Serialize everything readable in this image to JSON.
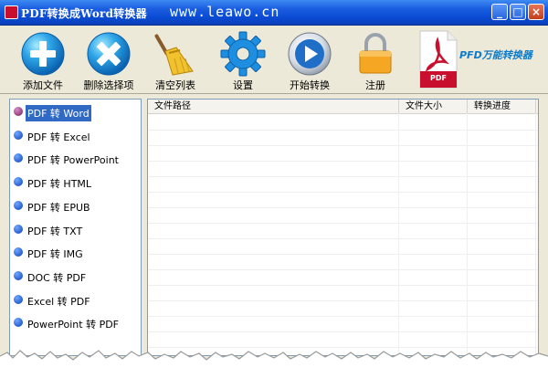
{
  "window": {
    "title": "PDF转换成Word转换器",
    "url": "www.leawo.cn",
    "controls": {
      "minimize": "_",
      "maximize": "□",
      "close": "×"
    }
  },
  "toolbar": {
    "items": [
      {
        "label": "添加文件",
        "icon": "add-icon"
      },
      {
        "label": "删除选择项",
        "icon": "remove-icon"
      },
      {
        "label": "清空列表",
        "icon": "broom-icon"
      },
      {
        "label": "设置",
        "icon": "gear-icon"
      },
      {
        "label": "开始转换",
        "icon": "play-icon"
      },
      {
        "label": "注册",
        "icon": "lock-icon"
      }
    ],
    "brand": {
      "text": "PFD万能转换器",
      "logo_text": "PDF",
      "icon": "pdf-logo-icon"
    }
  },
  "conversion_options": [
    {
      "label": "PDF 转 Word",
      "selected": true
    },
    {
      "label": "PDF 转 Excel",
      "selected": false
    },
    {
      "label": "PDF 转 PowerPoint",
      "selected": false
    },
    {
      "label": "PDF 转 HTML",
      "selected": false
    },
    {
      "label": "PDF 转 EPUB",
      "selected": false
    },
    {
      "label": "PDF 转 TXT",
      "selected": false
    },
    {
      "label": "PDF 转 IMG",
      "selected": false
    },
    {
      "label": "DOC 转 PDF",
      "selected": false
    },
    {
      "label": "Excel 转 PDF",
      "selected": false
    },
    {
      "label": "PowerPoint 转 PDF",
      "selected": false
    }
  ],
  "file_table": {
    "columns": [
      "文件路径",
      "文件大小",
      "转换进度"
    ],
    "rows": []
  },
  "colors": {
    "titlebar": "#0A4BD4",
    "selection": "#316AC5",
    "brand_text": "#0A7ACB",
    "pdf_red": "#C8102E"
  }
}
